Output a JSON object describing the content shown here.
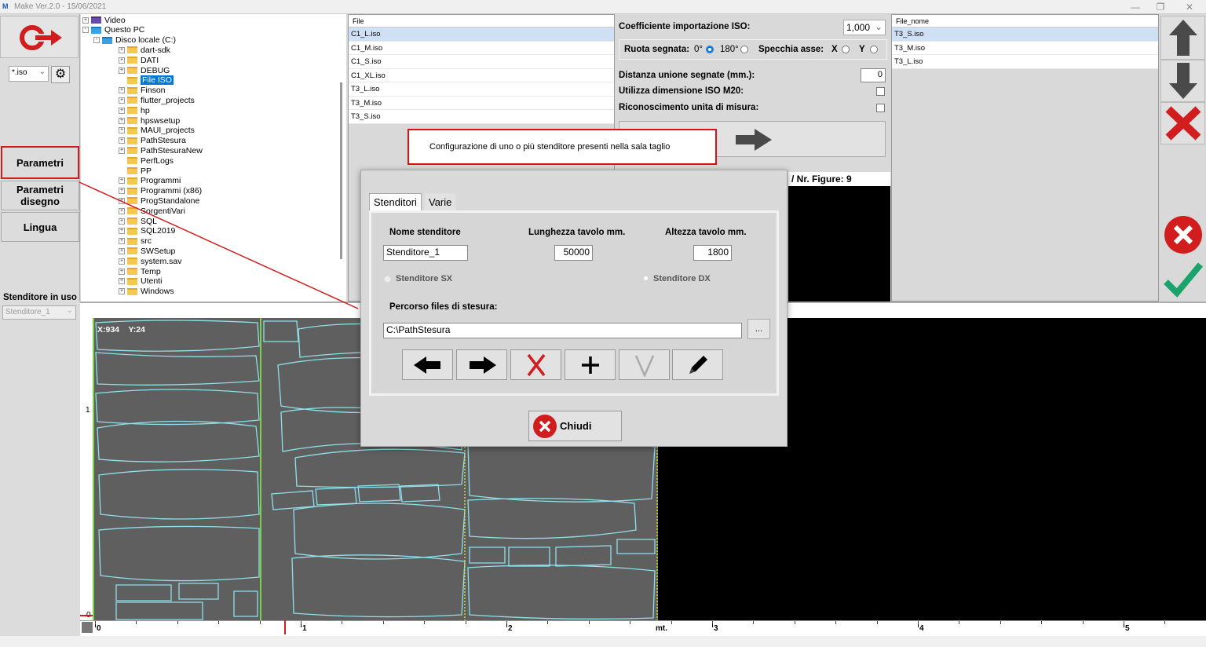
{
  "titlebar": {
    "title": "Make  Ver.2.0 - 15/06/2021",
    "minimize": "—",
    "restore": "❐",
    "close": "✕"
  },
  "left": {
    "filter_value": "*.iso",
    "nav": [
      "Parametri",
      "Parametri disegno",
      "Lingua"
    ],
    "stenditore_label": "Stenditore in uso",
    "stenditore_value": "Stenditore_1"
  },
  "tree": [
    {
      "label": "Video",
      "indent": 0,
      "icon": "video",
      "exp": "+"
    },
    {
      "label": "Questo PC",
      "indent": 0,
      "icon": "pc",
      "exp": "-"
    },
    {
      "label": "Disco locale (C:)",
      "indent": 1,
      "icon": "drive",
      "exp": "-"
    },
    {
      "label": "dart-sdk",
      "indent": 2,
      "exp": "+"
    },
    {
      "label": "DATI",
      "indent": 2,
      "exp": "+"
    },
    {
      "label": "DEBUG",
      "indent": 2,
      "exp": "+"
    },
    {
      "label": "File ISO",
      "indent": 2,
      "exp": "",
      "selected": true
    },
    {
      "label": "Finson",
      "indent": 2,
      "exp": "+"
    },
    {
      "label": "flutter_projects",
      "indent": 2,
      "exp": "+"
    },
    {
      "label": "hp",
      "indent": 2,
      "exp": "+"
    },
    {
      "label": "hpswsetup",
      "indent": 2,
      "exp": "+"
    },
    {
      "label": "MAUI_projects",
      "indent": 2,
      "exp": "+"
    },
    {
      "label": "PathStesura",
      "indent": 2,
      "exp": "+"
    },
    {
      "label": "PathStesuraNew",
      "indent": 2,
      "exp": "+"
    },
    {
      "label": "PerfLogs",
      "indent": 2,
      "exp": ""
    },
    {
      "label": "PP",
      "indent": 2,
      "exp": ""
    },
    {
      "label": "Programmi",
      "indent": 2,
      "exp": "+"
    },
    {
      "label": "Programmi (x86)",
      "indent": 2,
      "exp": "+"
    },
    {
      "label": "ProgStandalone",
      "indent": 2,
      "exp": "+"
    },
    {
      "label": "SorgentiVari",
      "indent": 2,
      "exp": "+"
    },
    {
      "label": "SQL",
      "indent": 2,
      "exp": "+"
    },
    {
      "label": "SQL2019",
      "indent": 2,
      "exp": "+"
    },
    {
      "label": "src",
      "indent": 2,
      "exp": "+"
    },
    {
      "label": "SWSetup",
      "indent": 2,
      "exp": "+"
    },
    {
      "label": "system.sav",
      "indent": 2,
      "exp": "+"
    },
    {
      "label": "Temp",
      "indent": 2,
      "exp": "+"
    },
    {
      "label": "Utenti",
      "indent": 2,
      "exp": "+"
    },
    {
      "label": "Windows",
      "indent": 2,
      "exp": "+"
    }
  ],
  "files": {
    "header": "File",
    "rows": [
      "C1_L.iso",
      "C1_M.iso",
      "C1_S.iso",
      "C1_XL.iso",
      "T3_L.iso",
      "T3_M.iso",
      "T3_S.iso"
    ],
    "selected_index": 0
  },
  "iso": {
    "coeff_label": "Coefficiente importazione ISO:",
    "coeff_value": "1,000",
    "ruota_label": "Ruota segnata:",
    "opt0": "0°",
    "opt180": "180°",
    "specchia_label": "Specchia asse:",
    "optX": "X",
    "optY": "Y",
    "distanza_label": "Distanza unione segnate (mm.):",
    "distanza_value": "0",
    "m20_label": "Utilizza dimensione ISO M20:",
    "unita_label": "Riconoscimento unita di misura:",
    "nr_figure": "/ Nr. Figure: 9"
  },
  "filenames": {
    "header": "File_nome",
    "rows": [
      "T3_S.iso",
      "T3_M.iso",
      "T3_L.iso"
    ],
    "selected_index": 0
  },
  "tooltip": "Configurazione di uno o più stenditore presenti nella sala taglio",
  "canvas": {
    "coords": "X:934    Y:24",
    "ruler_marks": [
      "0",
      "1",
      "2",
      "3",
      "4",
      "5"
    ],
    "unit": "mt.",
    "left_ticks": [
      "1",
      "0"
    ]
  },
  "dialog": {
    "tabs": [
      "Stenditori",
      "Varie"
    ],
    "nome_label": "Nome stenditore",
    "lunghezza_label": "Lunghezza tavolo mm.",
    "altezza_label": "Altezza tavolo mm.",
    "nome_value": "Stenditore_1",
    "lunghezza_value": "50000",
    "altezza_value": "1800",
    "sx_label": "Stenditore SX",
    "dx_label": "Stenditore DX",
    "percorso_label": "Percorso files di stesura:",
    "percorso_value": "C:\\PathStesura",
    "browse": "...",
    "close_label": "Chiudi"
  },
  "colors": {
    "accent_red": "#d11d1d",
    "check_green": "#1aa36b",
    "selection_blue": "#0078d7",
    "piece_outline": "#8fe0ea"
  }
}
